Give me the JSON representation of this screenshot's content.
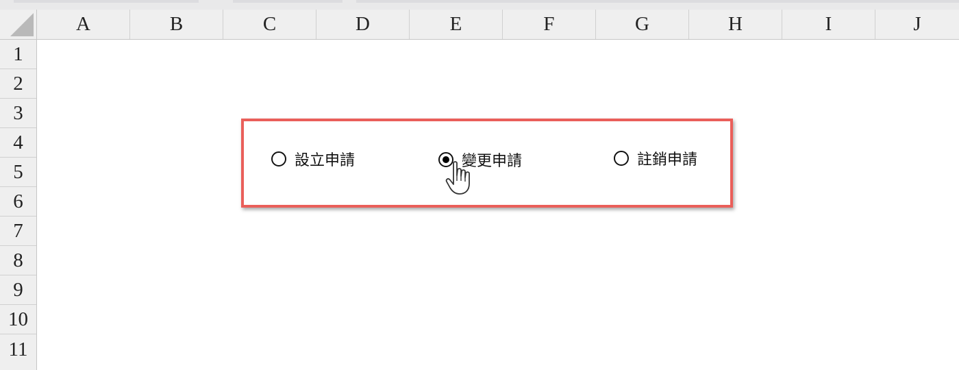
{
  "columns": [
    "A",
    "B",
    "C",
    "D",
    "E",
    "F",
    "G",
    "H",
    "I",
    "J"
  ],
  "rows": [
    "1",
    "2",
    "3",
    "4",
    "5",
    "6",
    "7",
    "8",
    "9",
    "10",
    "11"
  ],
  "option_group": {
    "options": [
      {
        "label": "設立申請",
        "selected": false
      },
      {
        "label": "變更申請",
        "selected": true
      },
      {
        "label": "註銷申請",
        "selected": false
      }
    ]
  },
  "colors": {
    "group_border": "#ea5f5a",
    "header_bg": "#efefef"
  },
  "cursor": {
    "icon": "hand-pointer-icon"
  }
}
